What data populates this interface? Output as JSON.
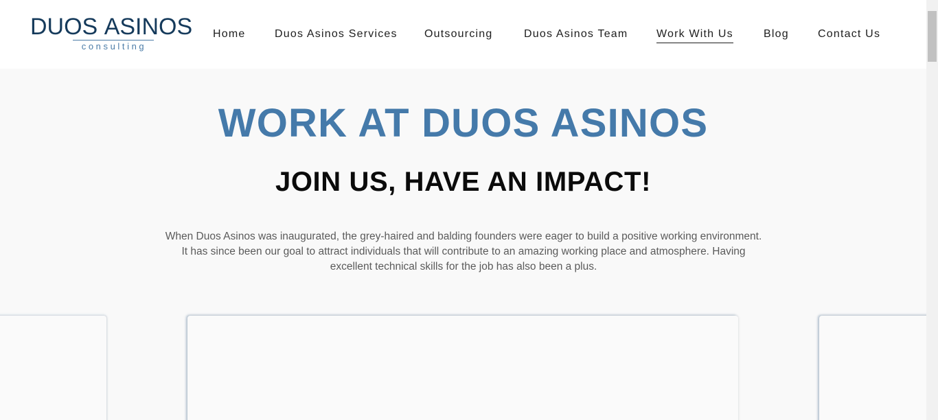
{
  "header": {
    "logo": {
      "main_light": "DUOS ",
      "main_bold": "ASINOS",
      "sub": "consulting"
    },
    "nav": [
      {
        "label": "Home",
        "active": false
      },
      {
        "label": "Duos Asinos Services",
        "active": false
      },
      {
        "label": "Outsourcing",
        "active": false
      },
      {
        "label": "Duos Asinos Team",
        "active": false
      },
      {
        "label": "Work With Us",
        "active": true
      },
      {
        "label": "Blog",
        "active": false
      },
      {
        "label": "Contact Us",
        "active": false
      }
    ]
  },
  "hero": {
    "title": "WORK AT DUOS ASINOS",
    "subtitle": "JOIN US, HAVE AN IMPACT!",
    "text": "When Duos Asinos was inaugurated, the grey-haired and balding founders were eager to build a positive working environment. It has since been our goal to attract individuals that will contribute to an amazing working place and atmosphere. Having excellent technical skills for the job has also been a plus."
  },
  "colors": {
    "accent": "#457aaa",
    "logo": "#153a5b",
    "background": "#f9f9f9"
  }
}
